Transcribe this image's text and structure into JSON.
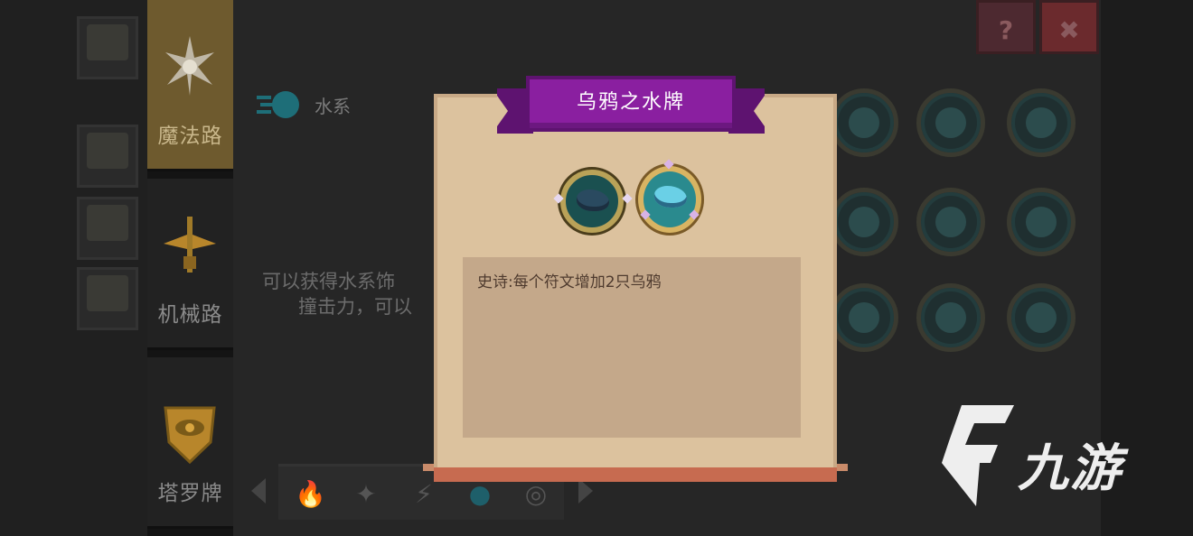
{
  "categories": [
    {
      "label": "魔法路",
      "active": true,
      "icon": "magic-star-icon"
    },
    {
      "label": "机械路",
      "active": false,
      "icon": "mechanic-wing-icon"
    },
    {
      "label": "塔罗牌",
      "active": false,
      "icon": "tarot-eye-icon"
    }
  ],
  "element": {
    "label": "水系",
    "icon": "water-element-icon"
  },
  "background_description": [
    "可以获得水系饰",
    "撞击力，可以"
  ],
  "top_buttons": {
    "help": "?",
    "close": "✖"
  },
  "bottom_tabs": [
    {
      "icon": "fire-icon",
      "glyph": "🔥"
    },
    {
      "icon": "star-icon",
      "glyph": "✦"
    },
    {
      "icon": "lightning-icon",
      "glyph": "⚡"
    },
    {
      "icon": "water-icon",
      "glyph": "●"
    },
    {
      "icon": "spiral-icon",
      "glyph": "◎"
    }
  ],
  "modal": {
    "title": "乌鸦之水牌",
    "rarity_levels": [
      "normal",
      "epic"
    ],
    "selected_rarity": "epic",
    "description": "史诗:每个符文增加2只乌鸦"
  },
  "watermark": {
    "text": "九游",
    "logo": "nine-game-logo"
  },
  "colors": {
    "banner": "#8a1fa0",
    "parchment": "#dcc29e",
    "description_panel": "#c4a88a",
    "active_category": "#6e5a2e"
  }
}
